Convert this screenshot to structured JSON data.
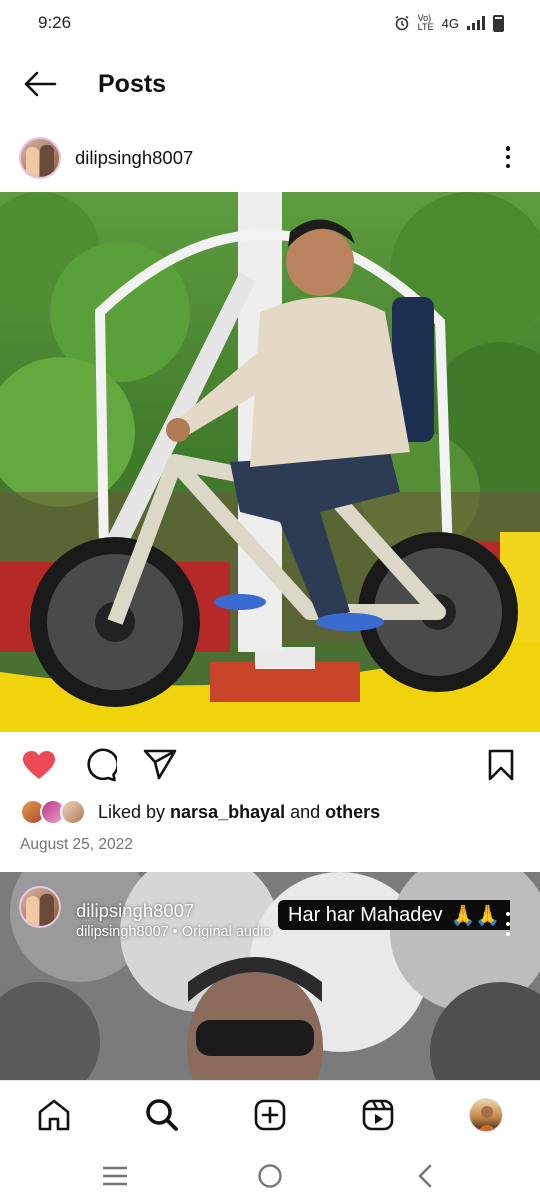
{
  "status_bar": {
    "time": "9:26",
    "network": "4G",
    "volte": "Vo) LTE"
  },
  "header": {
    "title": "Posts"
  },
  "post1": {
    "username": "dilipsingh8007",
    "liked_by_prefix": "Liked by ",
    "liked_by_user": "narsa_bhayal",
    "liked_by_and": " and ",
    "liked_by_others": "others",
    "date": "August 25, 2022",
    "liked": true
  },
  "post2": {
    "username": "dilipsingh8007",
    "audio": "dilipsingh8007 • Original audio",
    "caption": "Har har Mahadev",
    "caption_emoji": "🙏🙏"
  },
  "colors": {
    "like_red": "#ed4956",
    "meta_gray": "#737373"
  },
  "icons": {
    "actions": [
      "heart-icon",
      "comment-icon",
      "share-icon",
      "bookmark-icon"
    ],
    "nav": [
      "home-icon",
      "search-icon",
      "create-icon",
      "reels-icon",
      "profile-avatar"
    ],
    "system": [
      "recent-apps-icon",
      "home-circle-icon",
      "back-triangle-icon"
    ]
  }
}
